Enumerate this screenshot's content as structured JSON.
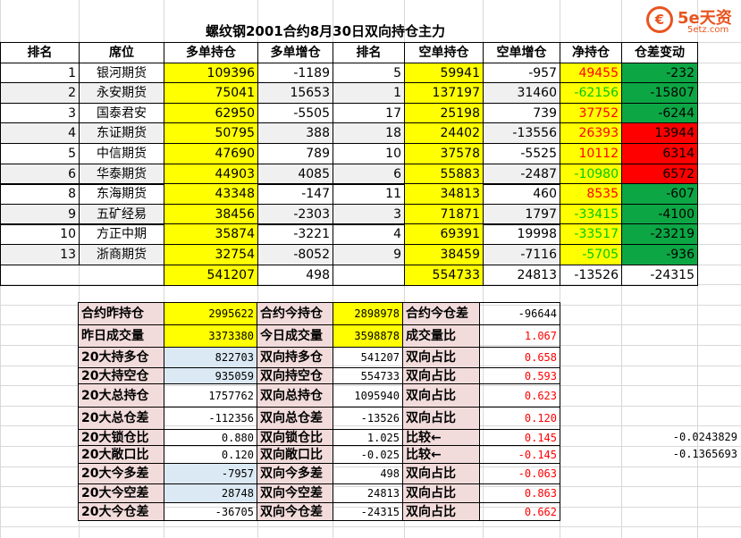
{
  "title": "螺纹钢2001合约8月30日双向持仓主力",
  "logo": {
    "brand": "5e天资",
    "domain": "5etz.com",
    "icon_text": "€"
  },
  "colors": {
    "yellow": "#ffff00",
    "green": "#0da645",
    "red": "#ff0000",
    "pink": "#f2dcdb",
    "lightblue": "#dbe9f4"
  },
  "main_table": {
    "headers": [
      "排名",
      "席位",
      "多单持仓",
      "多单增仓",
      "排名",
      "空单持仓",
      "空单增仓",
      "净持仓",
      "仓差变动"
    ],
    "rows": [
      {
        "rank": "1",
        "seat": "银河期货",
        "long": "109396",
        "long_chg": "-1189",
        "rank2": "5",
        "short": "59941",
        "short_chg": "-957",
        "net": "49455",
        "diff": "-232",
        "net_color": "red",
        "diff_color": "green"
      },
      {
        "rank": "2",
        "seat": "永安期货",
        "long": "75041",
        "long_chg": "15653",
        "rank2": "1",
        "short": "137197",
        "short_chg": "31460",
        "net": "-62156",
        "diff": "-15807",
        "net_color": "green",
        "diff_color": "green"
      },
      {
        "rank": "3",
        "seat": "国泰君安",
        "long": "62950",
        "long_chg": "-5505",
        "rank2": "17",
        "short": "25198",
        "short_chg": "739",
        "net": "37752",
        "diff": "-6244",
        "net_color": "red",
        "diff_color": "green"
      },
      {
        "rank": "4",
        "seat": "东证期货",
        "long": "50795",
        "long_chg": "388",
        "rank2": "18",
        "short": "24402",
        "short_chg": "-13556",
        "net": "26393",
        "diff": "13944",
        "net_color": "red",
        "diff_color": "red"
      },
      {
        "rank": "5",
        "seat": "中信期货",
        "long": "47690",
        "long_chg": "789",
        "rank2": "10",
        "short": "37578",
        "short_chg": "-5525",
        "net": "10112",
        "diff": "6314",
        "net_color": "red",
        "diff_color": "red"
      },
      {
        "rank": "6",
        "seat": "华泰期货",
        "long": "44903",
        "long_chg": "4085",
        "rank2": "6",
        "short": "55883",
        "short_chg": "-2487",
        "net": "-10980",
        "diff": "6572",
        "net_color": "green",
        "diff_color": "red"
      },
      {
        "rank": "8",
        "seat": "东海期货",
        "long": "43348",
        "long_chg": "-147",
        "rank2": "11",
        "short": "34813",
        "short_chg": "460",
        "net": "8535",
        "diff": "-607",
        "net_color": "red",
        "diff_color": "green"
      },
      {
        "rank": "9",
        "seat": "五矿经易",
        "long": "38456",
        "long_chg": "-2303",
        "rank2": "3",
        "short": "71871",
        "short_chg": "1797",
        "net": "-33415",
        "diff": "-4100",
        "net_color": "green",
        "diff_color": "green"
      },
      {
        "rank": "10",
        "seat": "方正中期",
        "long": "35874",
        "long_chg": "-3221",
        "rank2": "4",
        "short": "69391",
        "short_chg": "19998",
        "net": "-33517",
        "diff": "-23219",
        "net_color": "green",
        "diff_color": "green"
      },
      {
        "rank": "13",
        "seat": "浙商期货",
        "long": "32754",
        "long_chg": "-8052",
        "rank2": "9",
        "short": "38459",
        "short_chg": "-7116",
        "net": "-5705",
        "diff": "-936",
        "net_color": "green",
        "diff_color": "green"
      }
    ],
    "totals": {
      "long": "541207",
      "long_chg": "498",
      "short": "554733",
      "short_chg": "24813",
      "net": "-13526",
      "diff": "-24315"
    }
  },
  "summary_table": {
    "rows": [
      {
        "l1": "合约昨持仓",
        "v1": "2995622",
        "l2": "合约今持仓",
        "v2": "2898978",
        "l3": "合约今仓差",
        "v3": "-96644",
        "v1_bg": "yellow",
        "v2_bg": "yellow",
        "v3_color": "black"
      },
      {
        "l1": "昨日成交量",
        "v1": "3373380",
        "l2": "今日成交量",
        "v2": "3598878",
        "l3": "成交量比",
        "v3": "1.067",
        "v1_bg": "yellow",
        "v2_bg": "yellow",
        "v3_color": "red"
      },
      {
        "l1": "20大持多仓",
        "v1": "822703",
        "l2": "双向持多仓",
        "v2": "541207",
        "l3": "双向占比",
        "v3": "0.658",
        "v1_bg": "lightblue",
        "v2_bg": "none",
        "v3_color": "red"
      },
      {
        "l1": "20大持空仓",
        "v1": "935059",
        "l2": "双向持空仓",
        "v2": "554733",
        "l3": "双向占比",
        "v3": "0.593",
        "v1_bg": "lightblue",
        "v2_bg": "none",
        "v3_color": "red"
      },
      {
        "l1": "20大总持仓",
        "v1": "1757762",
        "l2": "双向总持仓",
        "v2": "1095940",
        "l3": "双向占比",
        "v3": "0.623",
        "v1_bg": "none",
        "v2_bg": "none",
        "v3_color": "red"
      },
      {
        "l1": "20大总仓差",
        "v1": "-112356",
        "l2": "双向总仓差",
        "v2": "-13526",
        "l3": "双向占比",
        "v3": "0.120",
        "v1_bg": "none",
        "v2_bg": "none",
        "v3_color": "red"
      },
      {
        "l1": "20大锁仓比",
        "v1": "0.880",
        "l2": "双向锁仓比",
        "v2": "1.025",
        "l3": "比较←",
        "v3": "0.145",
        "v1_bg": "none",
        "v2_bg": "none",
        "v3_color": "red"
      },
      {
        "l1": "20大敞口比",
        "v1": "0.120",
        "l2": "双向敞口比",
        "v2": "-0.025",
        "l3": "比较←",
        "v3": "-0.145",
        "v1_bg": "none",
        "v2_bg": "none",
        "v3_color": "red"
      },
      {
        "l1": "20大今多差",
        "v1": "-7957",
        "l2": "双向今多差",
        "v2": "498",
        "l3": "双向占比",
        "v3": "-0.063",
        "v1_bg": "lightblue",
        "v2_bg": "none",
        "v3_color": "red"
      },
      {
        "l1": "20大今空差",
        "v1": "28748",
        "l2": "双向今空差",
        "v2": "24813",
        "l3": "双向占比",
        "v3": "0.863",
        "v1_bg": "lightblue",
        "v2_bg": "none",
        "v3_color": "red"
      },
      {
        "l1": "20大今仓差",
        "v1": "-36705",
        "l2": "双向今仓差",
        "v2": "-24315",
        "l3": "双向占比",
        "v3": "0.662",
        "v1_bg": "none",
        "v2_bg": "none",
        "v3_color": "red"
      }
    ],
    "side_values": [
      "-0.0243829",
      "-0.1365693"
    ]
  }
}
